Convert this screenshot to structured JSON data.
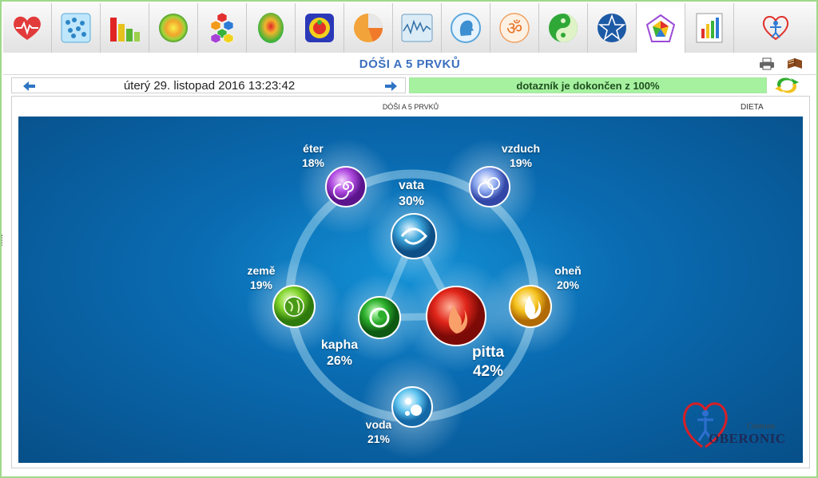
{
  "toolbar": {
    "tabs": [
      {
        "name": "heart-icon",
        "active": false
      },
      {
        "name": "dots-chart-icon",
        "active": false
      },
      {
        "name": "bar-chart-icon",
        "active": false
      },
      {
        "name": "aura-icon",
        "active": false
      },
      {
        "name": "hexagons-icon",
        "active": false
      },
      {
        "name": "heatmap-icon",
        "active": false
      },
      {
        "name": "body-energy-icon",
        "active": false
      },
      {
        "name": "pie-chart-icon",
        "active": false
      },
      {
        "name": "wave-chart-icon",
        "active": false
      },
      {
        "name": "head-profile-icon",
        "active": false
      },
      {
        "name": "om-icon",
        "active": false
      },
      {
        "name": "yin-yang-icon",
        "active": false
      },
      {
        "name": "star-icon",
        "active": false
      },
      {
        "name": "pentagon-elements-icon",
        "active": true
      },
      {
        "name": "report-chart-icon",
        "active": false
      },
      {
        "name": "oberonic-logo-icon",
        "active": false
      }
    ]
  },
  "header": {
    "title": "DÓŠI A 5 PRVKŮ"
  },
  "nav": {
    "date": "úterý 29. listopad 2016 13:23:42",
    "progress_text": "dotazník je dokončen z 100%",
    "progress_value": 1.0
  },
  "panel": {
    "label": "DÓŠI A 5 PRVKŮ",
    "dieta": "DIETA"
  },
  "elements": {
    "eter": {
      "name": "éter",
      "value": "18%"
    },
    "vzduch": {
      "name": "vzduch",
      "value": "19%"
    },
    "zeme": {
      "name": "země",
      "value": "19%"
    },
    "ohen": {
      "name": "oheň",
      "value": "20%"
    },
    "voda": {
      "name": "voda",
      "value": "21%"
    }
  },
  "doshas": {
    "vata": {
      "name": "vata",
      "value": "30%"
    },
    "kapha": {
      "name": "kapha",
      "value": "26%"
    },
    "pitta": {
      "name": "pitta",
      "value": "42%"
    }
  },
  "logo": {
    "small": "Centrum",
    "big": "OBERONIC"
  },
  "colors": {
    "title_blue": "#3a6fbf",
    "progress_green": "#a6f1a0",
    "canvas_blue": "#0a6bb1",
    "eter": "#b04ae0",
    "vzduch": "#6f8fe6",
    "zeme": "#7fd32a",
    "ohen": "#f5c21c",
    "voda": "#5fc4ef",
    "vata": "#3aa3d9",
    "kapha": "#2cb02c",
    "pitta": "#e0251a"
  }
}
